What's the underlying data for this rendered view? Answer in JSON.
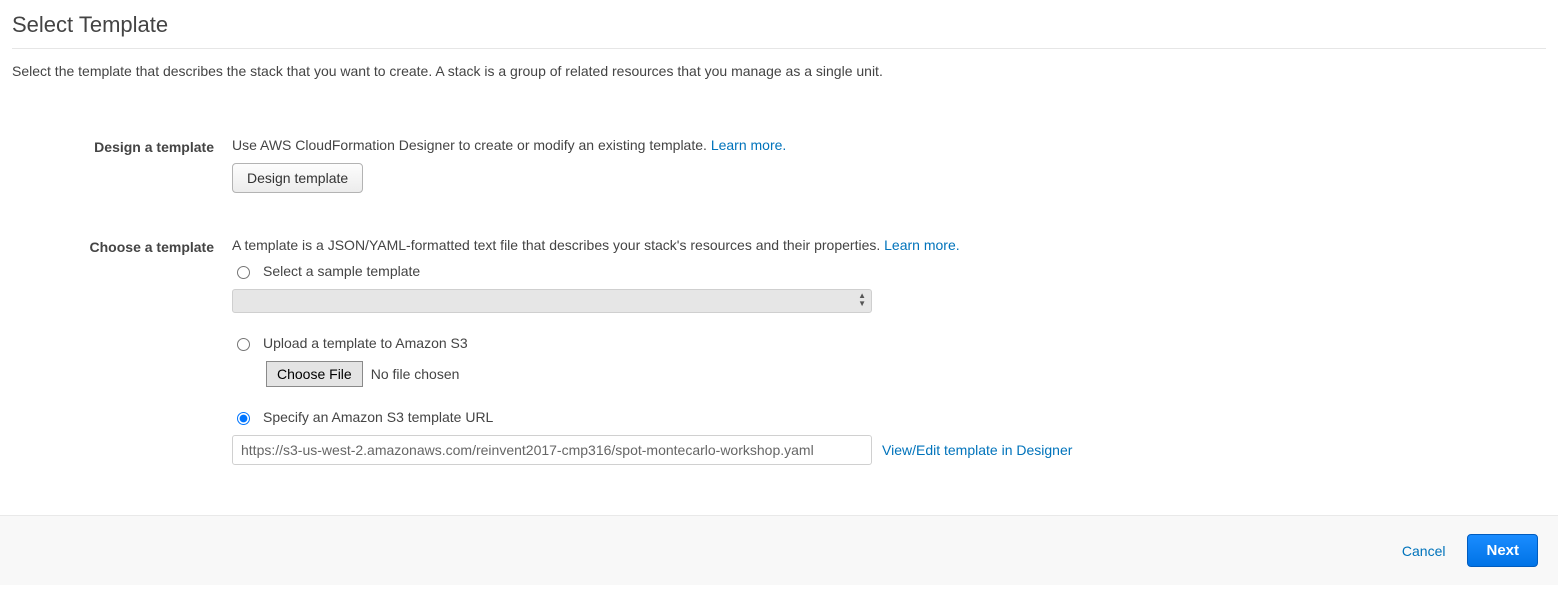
{
  "title": "Select Template",
  "intro": "Select the template that describes the stack that you want to create. A stack is a group of related resources that you manage as a single unit.",
  "design": {
    "label": "Design a template",
    "desc": "Use AWS CloudFormation Designer to create or modify an existing template. ",
    "learn_more": "Learn more.",
    "button": "Design template"
  },
  "choose": {
    "label": "Choose a template",
    "desc": "A template is a JSON/YAML-formatted text file that describes your stack's resources and their properties. ",
    "learn_more": "Learn more.",
    "option_sample": "Select a sample template",
    "option_upload": "Upload a template to Amazon S3",
    "choose_file_label": "Choose File",
    "no_file_text": "No file chosen",
    "option_url": "Specify an Amazon S3 template URL",
    "url_value": "https://s3-us-west-2.amazonaws.com/reinvent2017-cmp316/spot-montecarlo-workshop.yaml",
    "view_edit_link": "View/Edit template in Designer"
  },
  "footer": {
    "cancel": "Cancel",
    "next": "Next"
  }
}
